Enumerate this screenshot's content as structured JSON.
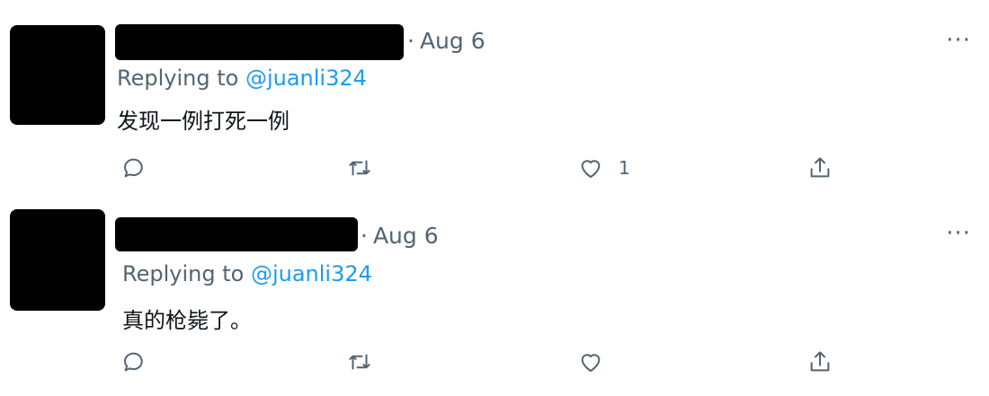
{
  "tweets": [
    {
      "date": "Aug 6",
      "reply_prefix": "Replying to",
      "reply_handle": "@juanli324",
      "text": "发现一例打死一例",
      "like_count": "1"
    },
    {
      "date": "Aug 6",
      "reply_prefix": "Replying to",
      "reply_handle": "@juanli324",
      "text": "真的枪毙了。",
      "like_count": ""
    }
  ],
  "ui": {
    "date_separator": "·",
    "more_label": "···"
  },
  "icons": {
    "reply": "reply-icon",
    "retweet": "retweet-icon",
    "like": "like-icon",
    "share": "share-icon"
  },
  "colors": {
    "handle": "#1d9bf0",
    "secondary_text": "#536471",
    "primary_text": "#0f1419"
  }
}
